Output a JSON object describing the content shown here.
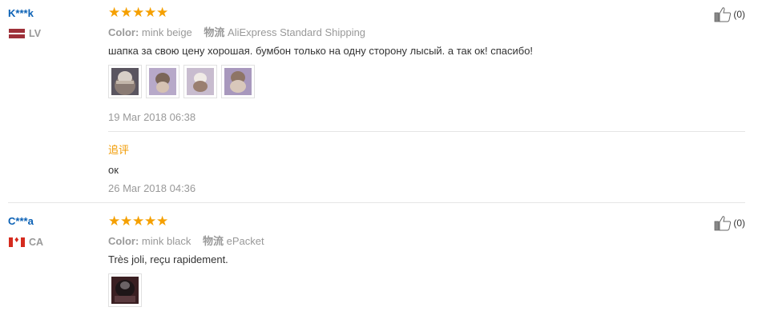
{
  "colors": {
    "star": "#f5a000",
    "username": "#0b61b5",
    "followup": "#f19a00",
    "muted": "#999999"
  },
  "reviews": [
    {
      "user": "K***k",
      "country": "LV",
      "flag_icon": "latvia-flag-icon",
      "rating": 5,
      "color_label": "Color:",
      "color_value": "mink beige",
      "shipping_label": "物流",
      "shipping_value": "AliExpress Standard Shipping",
      "text": "шапка за свою цену хорошая. бумбон только на одну сторону лысый. а так ок! спасибо!",
      "photo_count": 4,
      "date": "19 Mar 2018 06:38",
      "followup_label": "追评",
      "followup_text": "ок",
      "followup_date": "26 Mar 2018 04:36",
      "helpful_count": "(0)"
    },
    {
      "user": "C***a",
      "country": "CA",
      "flag_icon": "canada-flag-icon",
      "rating": 5,
      "color_label": "Color:",
      "color_value": "mink black",
      "shipping_label": "物流",
      "shipping_value": "ePacket",
      "text": "Très joli, reçu rapidement.",
      "photo_count": 1,
      "helpful_count": "(0)"
    }
  ]
}
